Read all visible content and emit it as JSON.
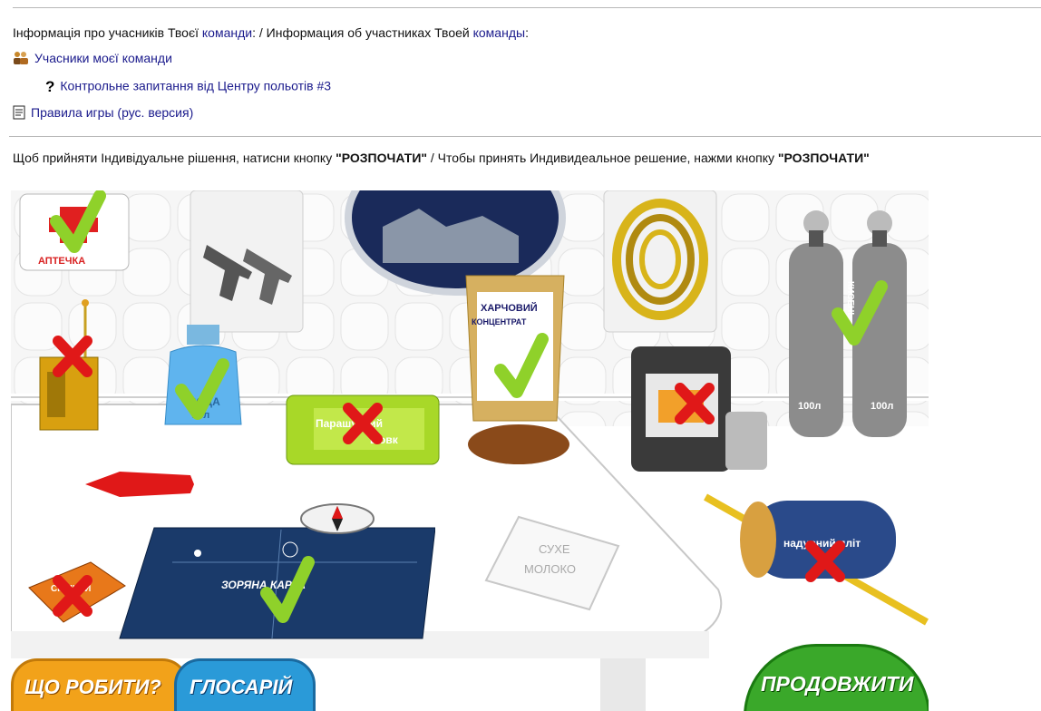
{
  "info": {
    "prefix": "Інформація про учасників Твоєї ",
    "link1": "команди",
    "middle": ": / Информация об участниках Твоей ",
    "link2": "команды",
    "suffix": ":"
  },
  "links": {
    "team": "Учасники моєї команди",
    "question": "Контрольне запитання від Центру польотів #3",
    "rules": "Правила игры (рус. версия)"
  },
  "instruction": {
    "part1": "Щоб прийняти Індивідуальне рішення, натисни кнопку ",
    "button1": "\"РОЗПОЧАТИ\"",
    "part2": " / Чтобы принять Индивидеальное решение, нажми кнопку ",
    "button2": "\"РОЗПОЧАТИ\""
  },
  "scene": {
    "first_aid": "АПТЕЧКА",
    "water_line1": "ВОДА",
    "water_line2": "20л",
    "food_line1": "ХАРЧОВИЙ",
    "food_line2": "КОНЦЕНТРАТ",
    "parachute_line1": "Парашутний",
    "parachute_line2": "шовк",
    "oxygen_label": "КИСЕНЬ",
    "oxygen_volume": "100л",
    "raft_label": "надувний пліт",
    "milk_line1": "СУХЕ",
    "milk_line2": "МОЛОКО",
    "map_label": "ЗОРЯНА КАРТА",
    "matches_label": "СІРНИКИ"
  },
  "buttons": {
    "what_to_do": "ЩО РОБИТИ?",
    "glossary": "ГЛОСАРІЙ",
    "continue": "ПРОДОВЖИТИ"
  },
  "colors": {
    "link": "#1a1a8c",
    "check": "#8fd12a",
    "cross": "#e01818",
    "continue_button": "#3aa82a",
    "glossary_button": "#2a9ad8",
    "what_button": "#f2a21a"
  }
}
